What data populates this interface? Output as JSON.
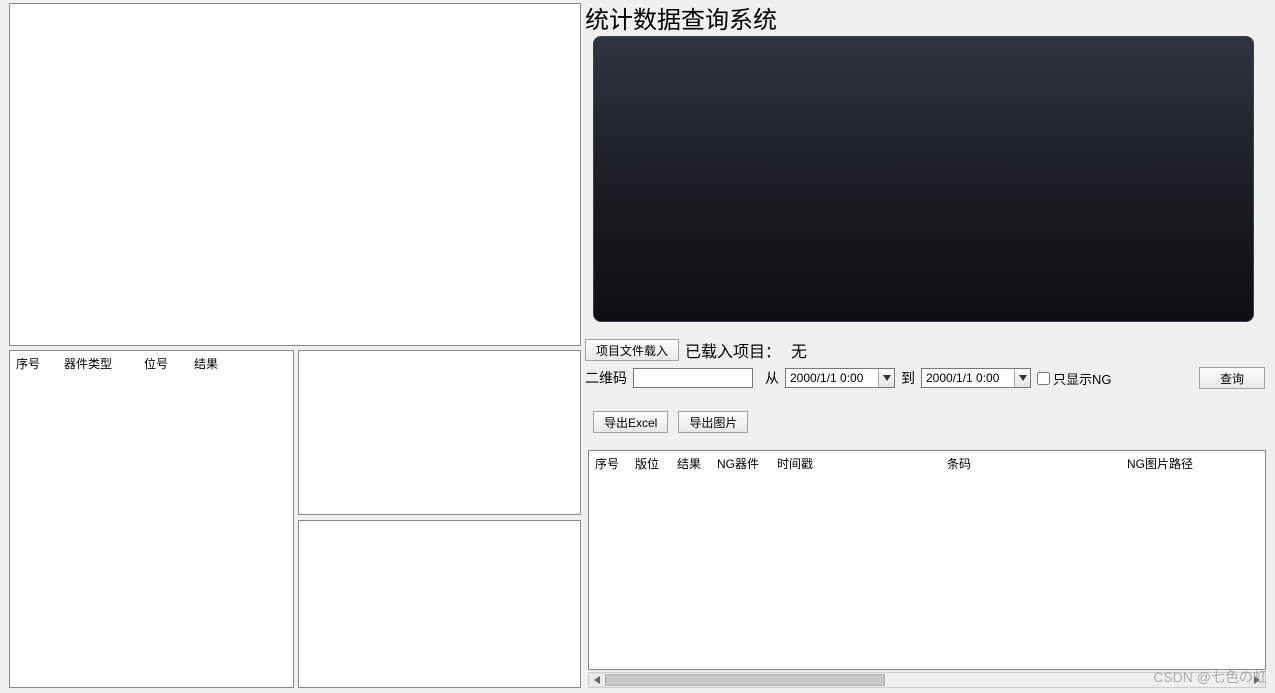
{
  "title": "统计数据查询系统",
  "left_table": {
    "columns": [
      "序号",
      "器件类型",
      "位号",
      "结果"
    ]
  },
  "load": {
    "button": "项目文件载入",
    "status_label": "已载入项目：",
    "status_value": "无"
  },
  "filter": {
    "qr_label": "二维码",
    "qr_value": "",
    "from_label": "从",
    "from_value": "2000/1/1 0:00",
    "to_label": "到",
    "to_value": "2000/1/1 0:00",
    "only_ng_label": "只显示NG",
    "query_button": "查询"
  },
  "export": {
    "excel": "导出Excel",
    "image": "导出图片"
  },
  "right_table": {
    "columns": [
      "序号",
      "版位",
      "结果",
      "NG器件",
      "时间戳",
      "条码",
      "NG图片路径"
    ]
  },
  "watermark": "CSDN @七色の虹"
}
